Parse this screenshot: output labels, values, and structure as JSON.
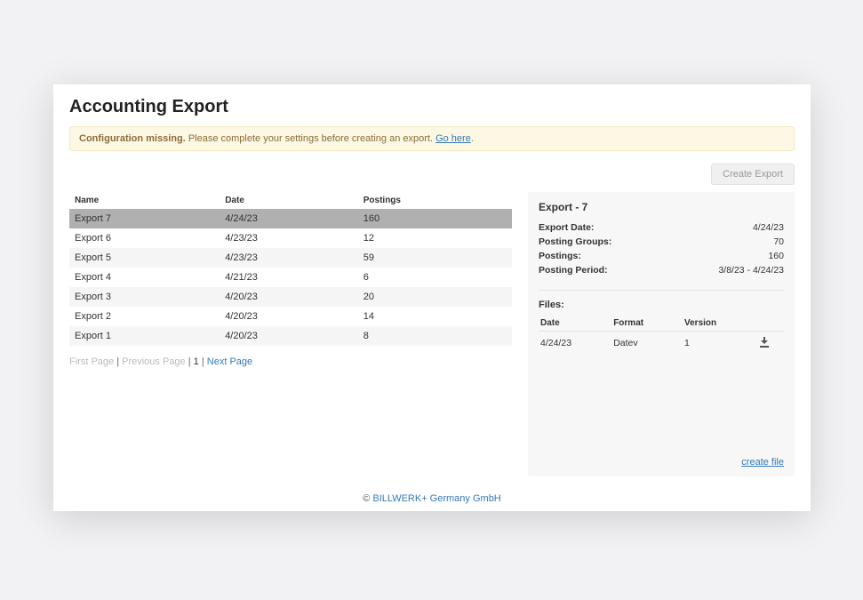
{
  "page": {
    "title": "Accounting Export"
  },
  "alert": {
    "strong": "Configuration missing.",
    "text": " Please complete your settings before creating an export. ",
    "link": "Go here",
    "tail": "."
  },
  "toolbar": {
    "create_export": "Create Export"
  },
  "table": {
    "headers": {
      "name": "Name",
      "date": "Date",
      "postings": "Postings"
    },
    "rows": [
      {
        "name": "Export 7",
        "date": "4/24/23",
        "postings": "160",
        "selected": true
      },
      {
        "name": "Export 6",
        "date": "4/23/23",
        "postings": "12"
      },
      {
        "name": "Export 5",
        "date": "4/23/23",
        "postings": "59"
      },
      {
        "name": "Export 4",
        "date": "4/21/23",
        "postings": "6"
      },
      {
        "name": "Export 3",
        "date": "4/20/23",
        "postings": "20"
      },
      {
        "name": "Export 2",
        "date": "4/20/23",
        "postings": "14"
      },
      {
        "name": "Export 1",
        "date": "4/20/23",
        "postings": "8"
      }
    ]
  },
  "pagination": {
    "first": "First Page",
    "prev": "Previous Page",
    "current": "1",
    "next": "Next Page"
  },
  "detail": {
    "title": "Export - 7",
    "rows": {
      "export_date": {
        "label": "Export Date:",
        "value": "4/24/23"
      },
      "posting_groups": {
        "label": "Posting Groups:",
        "value": "70"
      },
      "postings": {
        "label": "Postings:",
        "value": "160"
      },
      "posting_period": {
        "label": "Posting Period:",
        "value": "3/8/23 - 4/24/23"
      }
    },
    "files_title": "Files:",
    "files_headers": {
      "date": "Date",
      "format": "Format",
      "version": "Version"
    },
    "files": [
      {
        "date": "4/24/23",
        "format": "Datev",
        "version": "1"
      }
    ],
    "create_file": "create file"
  },
  "footer": {
    "copy": "© ",
    "link": "BILLWERK+ Germany GmbH"
  }
}
